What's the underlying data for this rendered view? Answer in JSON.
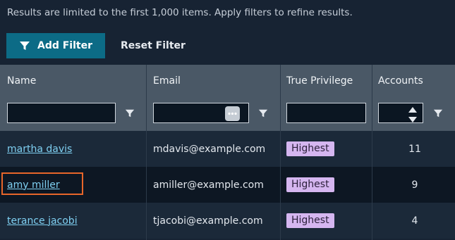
{
  "notice": "Results are limited to the first 1,000 items. Apply filters to refine results.",
  "toolbar": {
    "add_filter_label": "Add Filter",
    "reset_filter_label": "Reset Filter"
  },
  "columns": {
    "name": "Name",
    "email": "Email",
    "privilege": "True Privilege",
    "accounts": "Accounts"
  },
  "filters": {
    "name_value": "",
    "email_value": "",
    "privilege_value": "",
    "accounts_value": ""
  },
  "rows": [
    {
      "name": "martha davis",
      "email": "mdavis@example.com",
      "privilege": "Highest",
      "accounts": "11"
    },
    {
      "name": "amy miller",
      "email": "amiller@example.com",
      "privilege": "Highest",
      "accounts": "9"
    },
    {
      "name": "terance jacobi",
      "email": "tjacobi@example.com",
      "privilege": "Highest",
      "accounts": "4"
    }
  ],
  "colors": {
    "accent": "#0c6b86",
    "badge": "#d5b6f0",
    "link": "#7fd0f2",
    "highlight": "#e8662a"
  },
  "icons": {
    "add_filter": "funnel-icon",
    "column_filter": "funnel-icon",
    "email_options": "more-dots-icon",
    "accounts_spinner": "spinner-arrows-icon"
  }
}
